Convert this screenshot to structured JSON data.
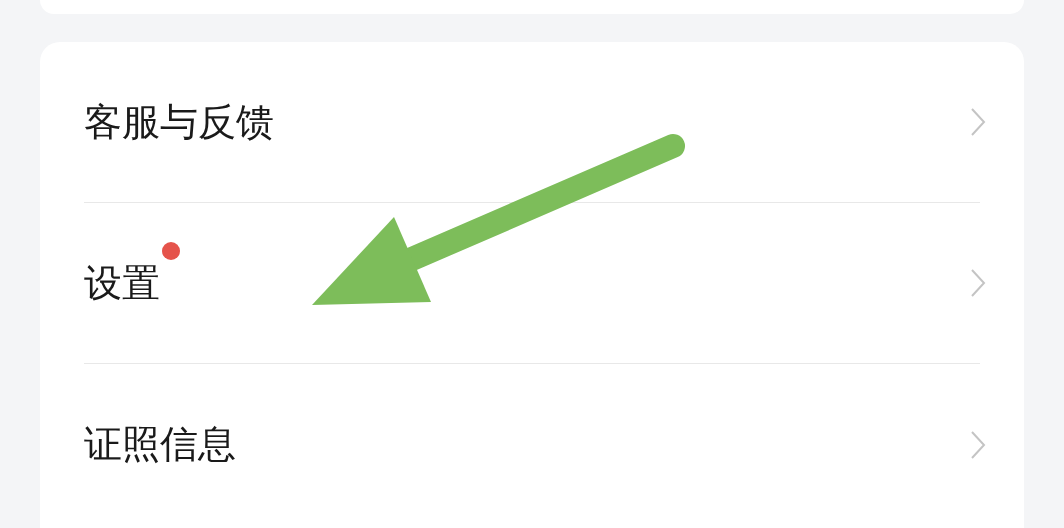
{
  "menu": {
    "rows": [
      {
        "label": "客服与反馈",
        "badge": false
      },
      {
        "label": "设置",
        "badge": true
      },
      {
        "label": "证照信息",
        "badge": false
      }
    ]
  },
  "annotation": {
    "kind": "arrow"
  }
}
